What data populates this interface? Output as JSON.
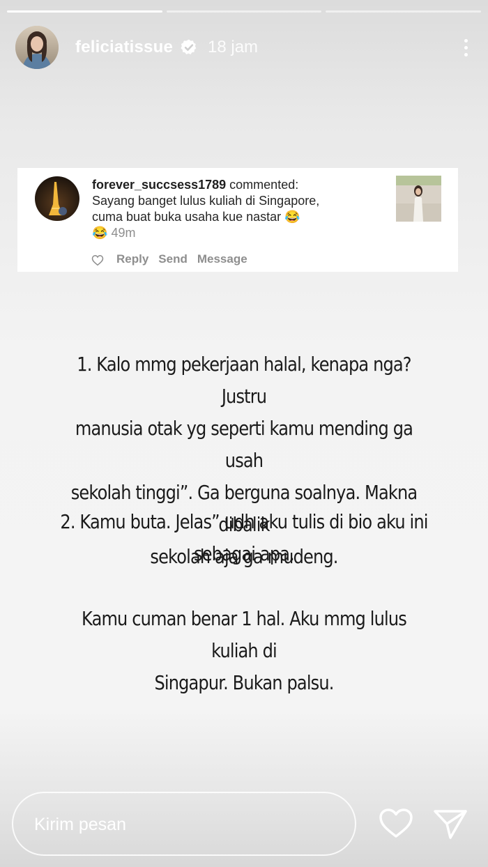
{
  "story": {
    "progress": [
      1.0,
      0.0,
      0.0
    ]
  },
  "header": {
    "username": "feliciatissue",
    "verified_icon": "verified-badge-icon",
    "time": "18 jam",
    "more_icon": "more-vertical-icon"
  },
  "comment": {
    "username": "forever_succsess1789",
    "action": "commented:",
    "text_line1": "Sayang banget lulus kuliah di Singapore,",
    "text_line2": "cuma buat buka usaha kue nastar",
    "emoji": "😂",
    "time": "49m",
    "heart_icon": "heart-outline-icon",
    "reply_label": "Reply",
    "send_label": "Send",
    "message_label": "Message"
  },
  "story_text": {
    "line1": "1. Kalo mmg pekerjaan halal, kenapa nga? Justru",
    "line2": "manusia otak yg seperti kamu mending ga usah",
    "line3": "sekolah tinggi”. Ga berguna soalnya. Makna dibalik",
    "line4": "sekolah aja ga mudeng.",
    "line5": "2. Kamu buta. Jelas” udh aku tulis di bio aku ini",
    "line6": "sebagai apa.",
    "line7": "Kamu cuman benar 1 hal. Aku mmg lulus kuliah di",
    "line8": "Singapur. Bukan palsu."
  },
  "footer": {
    "reply_placeholder": "Kirim pesan",
    "like_icon": "heart-outline-icon",
    "send_icon": "send-paper-plane-icon"
  },
  "colors": {
    "overlay_text": "#ffffff",
    "comment_text": "#262626",
    "muted": "#8e8e8e",
    "story_text": "#1a1a1a"
  }
}
